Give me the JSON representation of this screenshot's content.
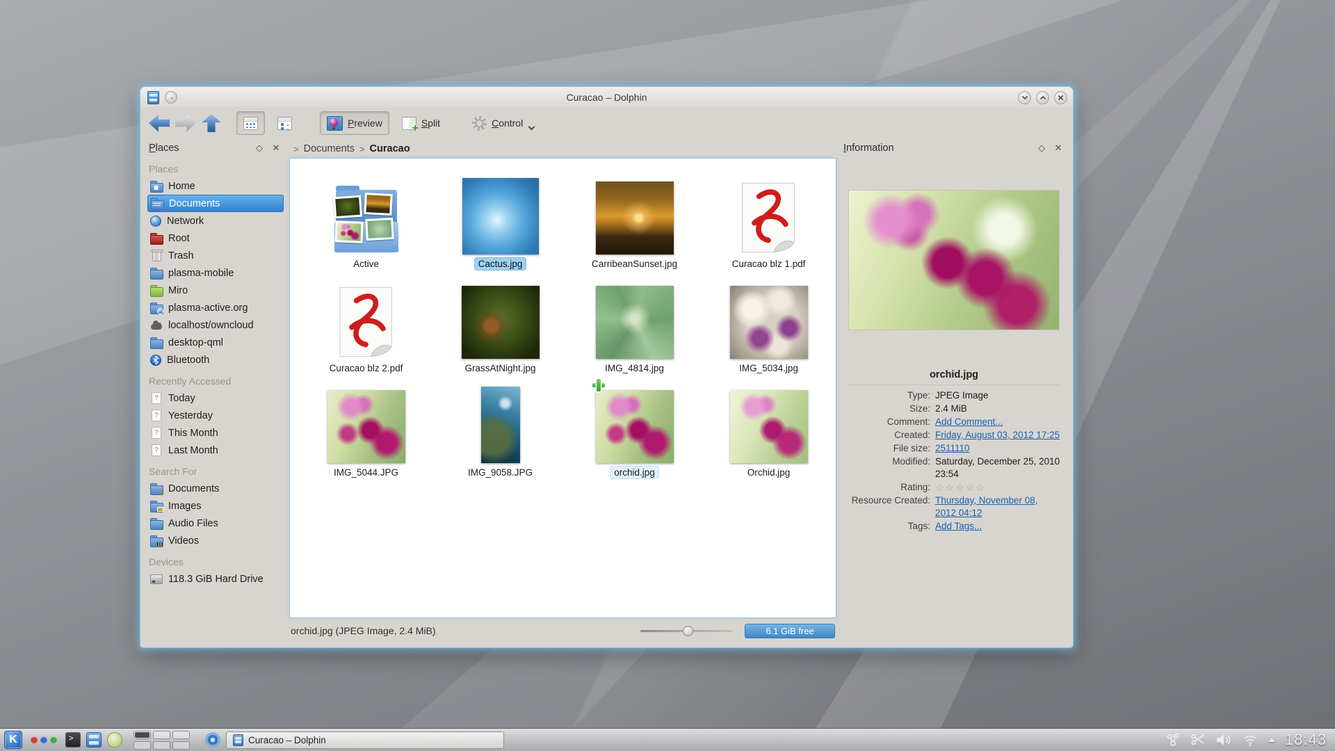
{
  "window": {
    "title": "Curacao – Dolphin"
  },
  "toolbar": {
    "preview_label": "Preview",
    "split_label": "Split",
    "control_label": "Control"
  },
  "breadcrumb": {
    "separator": ">",
    "items": [
      {
        "label": "Documents",
        "current": false
      },
      {
        "label": "Curacao",
        "current": true
      }
    ]
  },
  "places": {
    "title": "Places",
    "sections": [
      {
        "heading": "Places",
        "items": [
          {
            "label": "Home",
            "icon": "home-folder-icon"
          },
          {
            "label": "Documents",
            "icon": "documents-folder-icon",
            "selected": true
          },
          {
            "label": "Network",
            "icon": "network-globe-icon"
          },
          {
            "label": "Root",
            "icon": "root-folder-icon"
          },
          {
            "label": "Trash",
            "icon": "trash-icon"
          },
          {
            "label": "plasma-mobile",
            "icon": "folder-icon"
          },
          {
            "label": "Miro",
            "icon": "green-folder-icon"
          },
          {
            "label": "plasma-active.org",
            "icon": "web-folder-icon"
          },
          {
            "label": "localhost/owncloud",
            "icon": "cloud-icon"
          },
          {
            "label": "desktop-qml",
            "icon": "folder-icon"
          },
          {
            "label": "Bluetooth",
            "icon": "bluetooth-icon"
          }
        ]
      },
      {
        "heading": "Recently Accessed",
        "items": [
          {
            "label": "Today",
            "icon": "recent-document-icon"
          },
          {
            "label": "Yesterday",
            "icon": "recent-document-icon"
          },
          {
            "label": "This Month",
            "icon": "recent-document-icon"
          },
          {
            "label": "Last Month",
            "icon": "recent-document-icon"
          }
        ]
      },
      {
        "heading": "Search For",
        "items": [
          {
            "label": "Documents",
            "icon": "search-documents-icon"
          },
          {
            "label": "Images",
            "icon": "search-images-icon"
          },
          {
            "label": "Audio Files",
            "icon": "search-audio-icon"
          },
          {
            "label": "Videos",
            "icon": "search-videos-icon"
          }
        ]
      },
      {
        "heading": "Devices",
        "items": [
          {
            "label": "118.3 GiB Hard Drive",
            "icon": "hard-drive-icon"
          }
        ]
      }
    ]
  },
  "files": [
    {
      "name": "Active",
      "thumb": "active-folder"
    },
    {
      "name": "Cactus.jpg",
      "thumb": "cactus",
      "selected": true
    },
    {
      "name": "CarribeanSunset.jpg",
      "thumb": "sunset"
    },
    {
      "name": "Curacao blz 1.pdf",
      "thumb": "pdf"
    },
    {
      "name": "Curacao blz 2.pdf",
      "thumb": "pdf"
    },
    {
      "name": "GrassAtNight.jpg",
      "thumb": "grass"
    },
    {
      "name": "IMG_4814.jpg",
      "thumb": "aloe"
    },
    {
      "name": "IMG_5034.jpg",
      "thumb": "white-orchid"
    },
    {
      "name": "IMG_5044.JPG",
      "thumb": "pink-orchid"
    },
    {
      "name": "IMG_9058.JPG",
      "thumb": "underwater",
      "portrait": true
    },
    {
      "name": "orchid.jpg",
      "thumb": "pink-orchid",
      "hovered": true,
      "plus_badge": true
    },
    {
      "name": "Orchid.jpg",
      "thumb": "pink-orchid-light"
    }
  ],
  "info": {
    "title": "Information",
    "file_name": "orchid.jpg",
    "preview_icon": "orchid-photo-preview",
    "rows": [
      {
        "label": "Type:",
        "value": "JPEG Image"
      },
      {
        "label": "Size:",
        "value": "2.4 MiB"
      },
      {
        "label": "Comment:",
        "value": "Add Comment...",
        "link": true
      },
      {
        "label": "Created:",
        "value": "Friday, August 03, 2012 17:25",
        "link": true
      },
      {
        "label": "File size:",
        "value": "2511110",
        "link": true
      },
      {
        "label": "Modified:",
        "value": "Saturday, December 25, 2010 23:54"
      },
      {
        "label": "Rating:",
        "value": "☆☆☆☆☆",
        "stars": true
      },
      {
        "label": "Resource Created:",
        "value": "Thursday, November 08, 2012 04:12",
        "link": true
      },
      {
        "label": "Tags:",
        "value": "Add Tags...",
        "link": true
      }
    ]
  },
  "statusbar": {
    "summary": "orchid.jpg (JPEG Image, 2.4 MiB)",
    "free_space": "6.1 GiB free"
  },
  "taskbar": {
    "task_label": "Curacao – Dolphin",
    "clock": "18:43"
  }
}
